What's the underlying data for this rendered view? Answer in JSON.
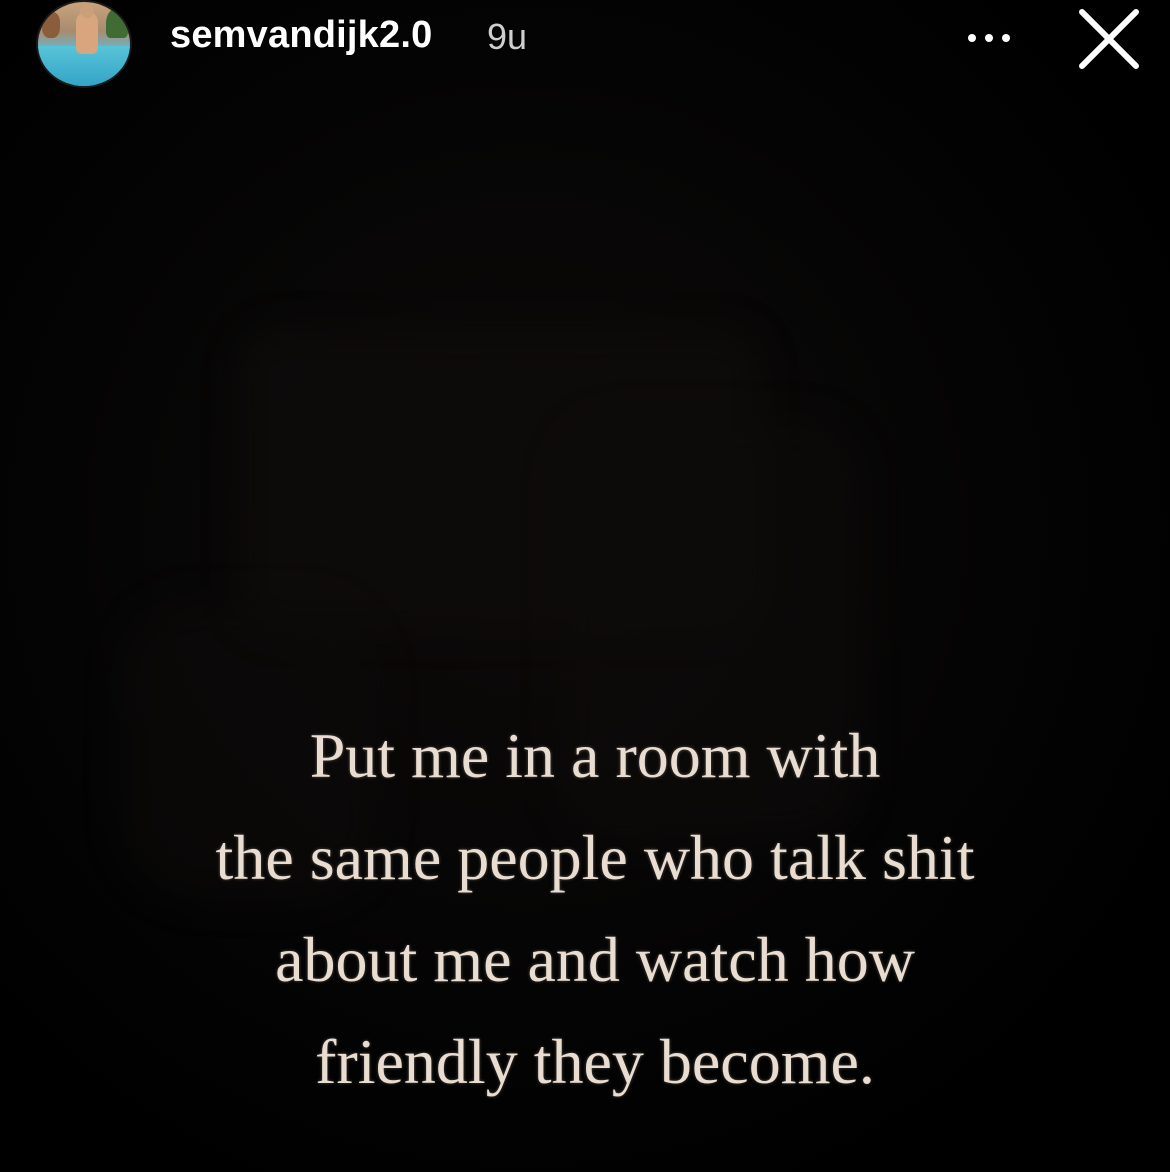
{
  "story": {
    "username": "semvandijk2.0",
    "time_ago": "9u",
    "avatar_icon": "profile-avatar",
    "more_icon": "more-horizontal-icon",
    "close_icon": "close-icon"
  },
  "content": {
    "quote_lines": [
      "Put me in a room with",
      "the same people who talk shit",
      "about me and watch how",
      "friendly they become."
    ]
  },
  "colors": {
    "background": "#000000",
    "text": "#ffffff",
    "quote_text": "#e9dcd0",
    "time_text": "#cfcfcf"
  }
}
